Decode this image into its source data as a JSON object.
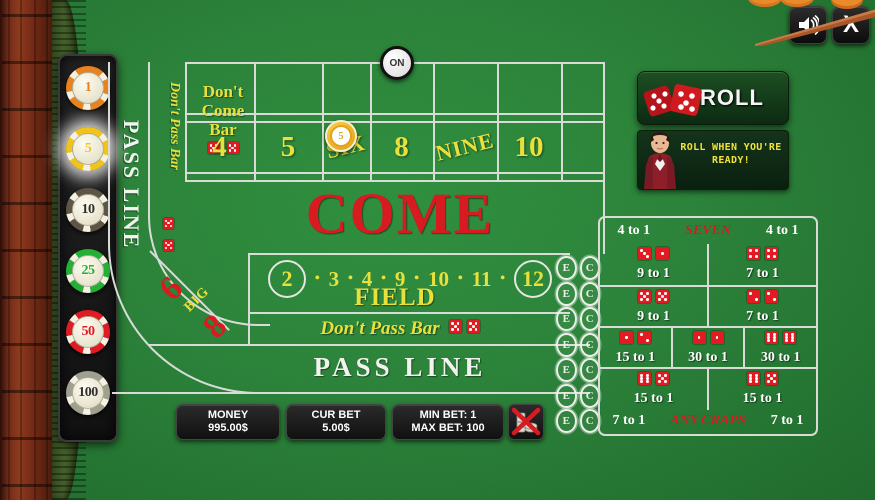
{
  "window": {
    "sound_button": "speaker-icon",
    "close_button": "X"
  },
  "chip_rack": {
    "chips": [
      {
        "value": "1",
        "color": "#e8821f",
        "selected": false
      },
      {
        "value": "5",
        "color": "#f0c41b",
        "selected": true
      },
      {
        "value": "10",
        "color": "#5d5645",
        "selected": false
      },
      {
        "value": "25",
        "color": "#24b034",
        "selected": false
      },
      {
        "value": "50",
        "color": "#e01b24",
        "selected": false
      },
      {
        "value": "100",
        "color": "#9fa08e",
        "selected": false
      }
    ]
  },
  "table": {
    "puck_label": "ON",
    "pass_line_vertical": "PASS LINE",
    "dont_pass_bar_vertical": "Don't Pass Bar",
    "dont_come_bar": "Don't\nCome\nBar",
    "dont_come_bar_lines": [
      "Don't",
      "Come",
      "Bar"
    ],
    "come_label": "COME",
    "field_label": "FIELD",
    "field_numbers": [
      "2",
      "3",
      "4",
      "9",
      "10",
      "11",
      "12"
    ],
    "field_circled": [
      "2",
      "12"
    ],
    "dont_pass_bar_label": "Don't Pass Bar",
    "pass_line_label": "PASS LINE",
    "big_6": "6",
    "big_8": "8",
    "big_label": "BIG",
    "point_numbers": [
      "4",
      "5",
      "6",
      "8",
      "9",
      "10"
    ],
    "point_number_labels": [
      "4",
      "5",
      "SIX",
      "8",
      "NINE",
      "10"
    ],
    "placed_chip": {
      "on_number": "5",
      "value": "5"
    }
  },
  "ec_bets": {
    "e_label": "E",
    "c_label": "C",
    "pair_count": 7
  },
  "proposition": {
    "top_bar": {
      "left": "4 to 1",
      "center": "SEVEN",
      "right": "4 to 1"
    },
    "bottom_bar": {
      "left": "7 to 1",
      "center": "ANY CRAPS",
      "right": "7 to 1"
    },
    "rows": [
      [
        {
          "payout": "9 to 1",
          "dice": [
            3,
            1
          ]
        },
        {
          "payout": "7 to 1",
          "dice": [
            4,
            4
          ]
        }
      ],
      [
        {
          "payout": "9 to 1",
          "dice": [
            5,
            5
          ]
        },
        {
          "payout": "7 to 1",
          "dice": [
            2,
            2
          ]
        }
      ],
      [
        {
          "payout": "15 to 1",
          "dice": [
            1,
            2
          ]
        },
        {
          "payout": "30 to 1",
          "dice": [
            1,
            1
          ]
        },
        {
          "payout": "30 to 1",
          "dice": [
            6,
            6
          ]
        }
      ],
      [
        {
          "payout": "15 to 1",
          "dice": [
            6,
            5
          ]
        },
        {
          "payout": "15 to 1",
          "dice": [
            6,
            5
          ]
        }
      ]
    ]
  },
  "controls": {
    "roll_label": "ROLL",
    "dealer_message": "ROLL WHEN YOU'RE READY!",
    "clear_bets": "clear-bets-icon"
  },
  "status": {
    "money_label": "MONEY",
    "money_value": "995.00$",
    "cur_bet_label": "CUR BET",
    "cur_bet_value": "5.00$",
    "min_bet": "MIN BET: 1",
    "max_bet": "MAX BET: 100"
  },
  "colors": {
    "felt": "#2b8239",
    "line": "#d9dcd6",
    "yellow": "#e9e03c",
    "red": "#d81b21",
    "white": "#f2f3ee"
  }
}
